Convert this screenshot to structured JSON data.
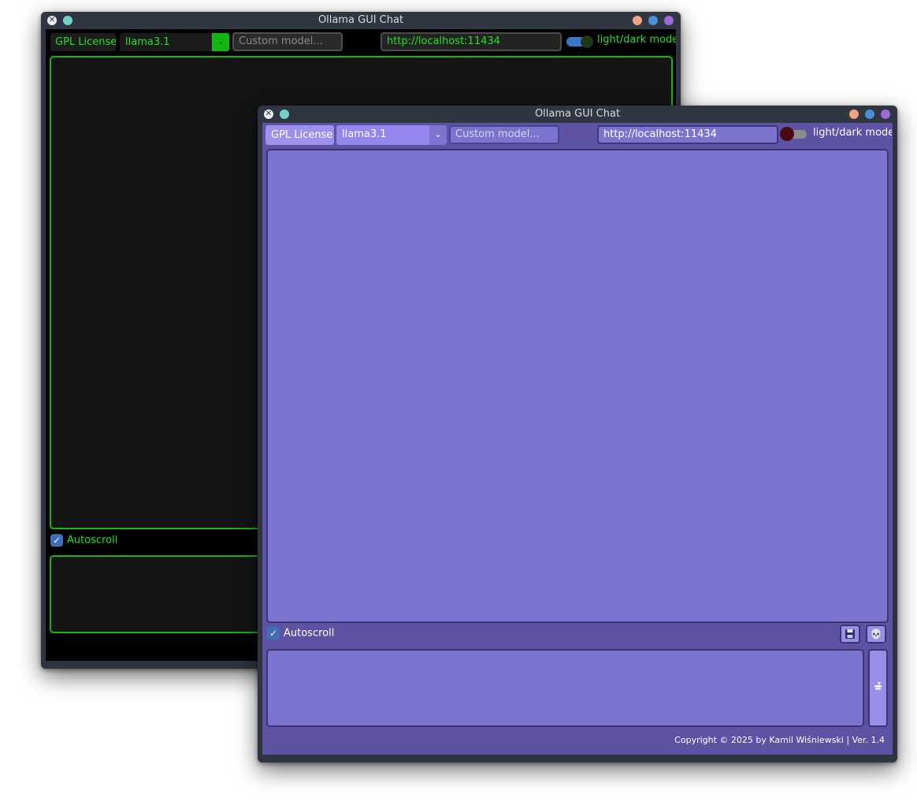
{
  "windows": {
    "back": {
      "title": "Ollama GUI Chat",
      "license_label": "GPL License",
      "model_value": "llama3.1",
      "custom_model_placeholder": "Custom model...",
      "server_url": "http://localhost:11434",
      "mode_label": "light/dark mode",
      "autoscroll_label": "Autoscroll",
      "theme": "dark-green",
      "accent_color": "#11b811"
    },
    "front": {
      "title": "Ollama GUI Chat",
      "license_label": "GPL License",
      "model_value": "llama3.1",
      "custom_model_placeholder": "Custom model...",
      "server_url": "http://localhost:11434",
      "mode_label": "light/dark mode",
      "autoscroll_label": "Autoscroll",
      "save_icon": "floppy-disk-icon",
      "clear_icon": "skull-icon",
      "send_icon": "send-icon",
      "copyright": "Copyright © 2025 by Kamil Wiśniewski | Ver. 1.4",
      "theme": "purple",
      "accent_color": "#7b74cf"
    }
  },
  "titlebar_colors": {
    "pin": "#6fd3c8",
    "minimize": "#f0a384",
    "maximize": "#4a8fd8",
    "close": "#9a6ad6"
  }
}
